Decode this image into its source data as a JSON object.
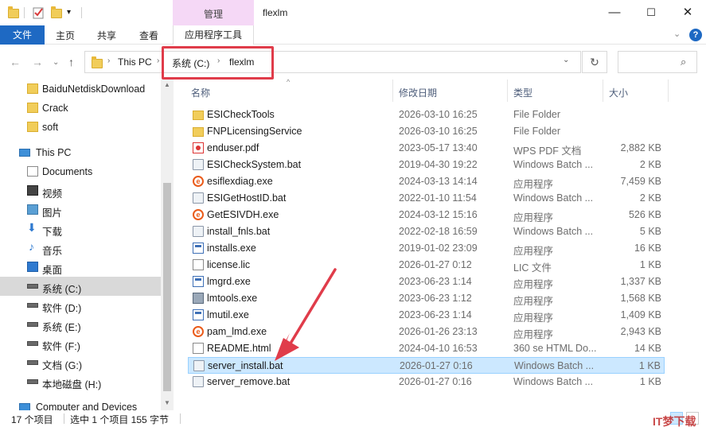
{
  "window": {
    "title": "flexlm",
    "context_tab": "管理",
    "minimize": "—",
    "maximize": "☐",
    "close": "✕"
  },
  "ribbon": {
    "file": "文件",
    "home": "主页",
    "share": "共享",
    "view": "查看",
    "app_tools": "应用程序工具",
    "expand": "⌄",
    "help": "?"
  },
  "address": {
    "segments": [
      "This PC",
      "系统 (C:)",
      "flexlm"
    ],
    "back": "←",
    "forward": "→",
    "recent": "⌄",
    "up": "↑",
    "dropdown": "⌄",
    "refresh": "↻",
    "search_icon": "⌕"
  },
  "nav": {
    "items": [
      {
        "label": "BaiduNetdiskDownload",
        "icon": "folder-icon"
      },
      {
        "label": "Crack",
        "icon": "folder-icon"
      },
      {
        "label": "soft",
        "icon": "folder-icon"
      },
      {
        "label": "This PC",
        "icon": "computer-icon"
      },
      {
        "label": "Documents",
        "icon": "documents-icon"
      },
      {
        "label": "视频",
        "icon": "video-icon"
      },
      {
        "label": "图片",
        "icon": "pictures-icon"
      },
      {
        "label": "下载",
        "icon": "download-icon"
      },
      {
        "label": "音乐",
        "icon": "music-icon"
      },
      {
        "label": "桌面",
        "icon": "desktop-icon"
      },
      {
        "label": "系统 (C:)",
        "icon": "drive-icon"
      },
      {
        "label": "软件 (D:)",
        "icon": "drive-icon"
      },
      {
        "label": "系统 (E:)",
        "icon": "drive-icon"
      },
      {
        "label": "软件 (F:)",
        "icon": "drive-icon"
      },
      {
        "label": "文档 (G:)",
        "icon": "drive-icon"
      },
      {
        "label": "本地磁盘 (H:)",
        "icon": "drive-icon"
      },
      {
        "label": "Computer and Devices",
        "icon": "network-icon"
      }
    ]
  },
  "columns": {
    "name": "名称",
    "date": "修改日期",
    "type": "类型",
    "size": "大小",
    "sort_indicator": "^"
  },
  "files": [
    {
      "name": "ESICheckTools",
      "date": "2026-03-10 16:25",
      "type": "File Folder",
      "size": "",
      "icon": "folder-icon"
    },
    {
      "name": "FNPLicensingService",
      "date": "2026-03-10 16:25",
      "type": "File Folder",
      "size": "",
      "icon": "folder-icon"
    },
    {
      "name": "enduser.pdf",
      "date": "2023-05-17 13:40",
      "type": "WPS PDF 文档",
      "size": "2,882 KB",
      "icon": "pdf-icon"
    },
    {
      "name": "ESICheckSystem.bat",
      "date": "2019-04-30 19:22",
      "type": "Windows Batch ...",
      "size": "2 KB",
      "icon": "batch-file-icon"
    },
    {
      "name": "esiflexdiag.exe",
      "date": "2024-03-13 14:14",
      "type": "应用程序",
      "size": "7,459 KB",
      "icon": "orange-e-app-icon"
    },
    {
      "name": "ESIGetHostID.bat",
      "date": "2022-01-10 11:54",
      "type": "Windows Batch ...",
      "size": "2 KB",
      "icon": "batch-file-icon"
    },
    {
      "name": "GetESIVDH.exe",
      "date": "2024-03-12 15:16",
      "type": "应用程序",
      "size": "526 KB",
      "icon": "orange-e-app-icon"
    },
    {
      "name": "install_fnls.bat",
      "date": "2022-02-18 16:59",
      "type": "Windows Batch ...",
      "size": "5 KB",
      "icon": "batch-file-icon"
    },
    {
      "name": "installs.exe",
      "date": "2019-01-02 23:09",
      "type": "应用程序",
      "size": "16 KB",
      "icon": "app-window-icon"
    },
    {
      "name": "license.lic",
      "date": "2026-01-27 0:12",
      "type": "LIC 文件",
      "size": "1 KB",
      "icon": "blank-file-icon"
    },
    {
      "name": "lmgrd.exe",
      "date": "2023-06-23 1:14",
      "type": "应用程序",
      "size": "1,337 KB",
      "icon": "app-window-icon"
    },
    {
      "name": "lmtools.exe",
      "date": "2023-06-23 1:12",
      "type": "应用程序",
      "size": "1,568 KB",
      "icon": "tools-app-icon"
    },
    {
      "name": "lmutil.exe",
      "date": "2023-06-23 1:14",
      "type": "应用程序",
      "size": "1,409 KB",
      "icon": "app-window-icon"
    },
    {
      "name": "pam_lmd.exe",
      "date": "2026-01-26 23:13",
      "type": "应用程序",
      "size": "2,943 KB",
      "icon": "orange-e-app-icon"
    },
    {
      "name": "README.html",
      "date": "2024-04-10 16:53",
      "type": "360 se HTML Do...",
      "size": "14 KB",
      "icon": "html-file-icon"
    },
    {
      "name": "server_install.bat",
      "date": "2026-01-27 0:16",
      "type": "Windows Batch ...",
      "size": "1 KB",
      "icon": "batch-file-icon",
      "selected": true
    },
    {
      "name": "server_remove.bat",
      "date": "2026-01-27 0:16",
      "type": "Windows Batch ...",
      "size": "1 KB",
      "icon": "batch-file-icon"
    }
  ],
  "status": {
    "count": "17 个项目",
    "selection": "选中 1 个项目  155 字节"
  },
  "watermark": "IT梦下载网",
  "colors": {
    "accent": "#1e69c3",
    "context_tab": "#f5d8f6",
    "selection": "#cce8ff",
    "annotation": "#e03c4a"
  }
}
